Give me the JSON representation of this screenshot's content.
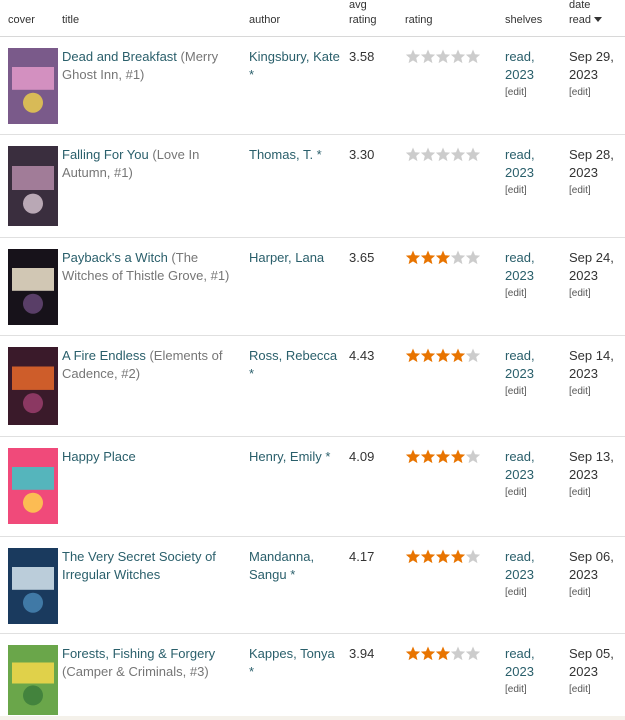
{
  "header": {
    "cover": "cover",
    "title": "title",
    "author": "author",
    "avg_rating": "avg\nrating",
    "avg_rating_line1": "avg",
    "avg_rating_line2": "rating",
    "rating": "rating",
    "shelves": "shelves",
    "date_read_line1": "date",
    "date_read_line2": "read"
  },
  "colors": {
    "link": "#2a5f6b",
    "star_filled": "#e87400",
    "star_empty": "#cccccc"
  },
  "books": [
    {
      "title": "Dead and Breakfast",
      "series": "(Merry Ghost Inn, #1)",
      "author": "Kingsbury, Kate *",
      "avg_rating": "3.58",
      "rating": 0,
      "shelf": "read, 2023",
      "edit": "[edit]",
      "date_read": "Sep 29, 2023",
      "date_edit": "[edit]"
    },
    {
      "title": "Falling For You",
      "series": "(Love In Autumn, #1)",
      "author": "Thomas, T. *",
      "avg_rating": "3.30",
      "rating": 0,
      "shelf": "read, 2023",
      "edit": "[edit]",
      "date_read": "Sep 28, 2023",
      "date_edit": "[edit]"
    },
    {
      "title": "Payback's a Witch",
      "series": "(The Witches of Thistle Grove, #1)",
      "author": "Harper, Lana",
      "avg_rating": "3.65",
      "rating": 3,
      "shelf": "read, 2023",
      "edit": "[edit]",
      "date_read": "Sep 24, 2023",
      "date_edit": "[edit]"
    },
    {
      "title": "A Fire Endless",
      "series": "(Elements of Cadence, #2)",
      "author": "Ross, Rebecca *",
      "avg_rating": "4.43",
      "rating": 4,
      "shelf": "read, 2023",
      "edit": "[edit]",
      "date_read": "Sep 14, 2023",
      "date_edit": "[edit]"
    },
    {
      "title": "Happy Place",
      "series": "",
      "author": "Henry, Emily *",
      "avg_rating": "4.09",
      "rating": 4,
      "shelf": "read, 2023",
      "edit": "[edit]",
      "date_read": "Sep 13, 2023",
      "date_edit": "[edit]"
    },
    {
      "title": "The Very Secret Society of Irregular Witches",
      "series": "",
      "author": "Mandanna, Sangu *",
      "avg_rating": "4.17",
      "rating": 4,
      "shelf": "read, 2023",
      "edit": "[edit]",
      "date_read": "Sep 06, 2023",
      "date_edit": "[edit]"
    },
    {
      "title": "Forests, Fishing & Forgery",
      "series": "(Camper & Criminals, #3)",
      "author": "Kappes, Tonya *",
      "avg_rating": "3.94",
      "rating": 3,
      "shelf": "read, 2023",
      "edit": "[edit]",
      "date_read": "Sep 05, 2023",
      "date_edit": "[edit]"
    }
  ]
}
